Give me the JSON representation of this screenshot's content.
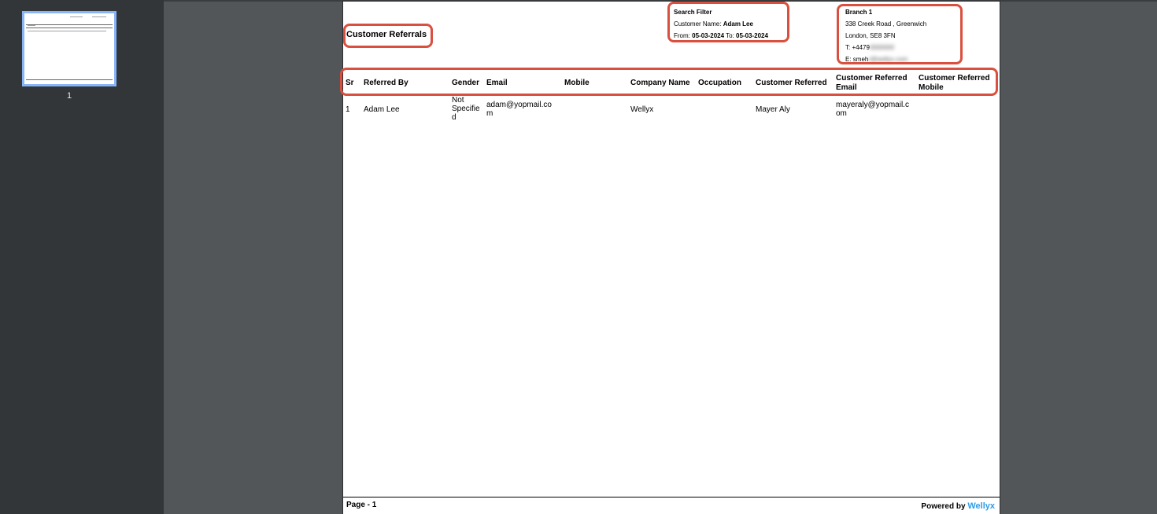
{
  "sidebar": {
    "page_number": "1"
  },
  "report": {
    "title": "Customer Referrals",
    "filter": {
      "heading": "Search Filter",
      "customer_label": "Customer Name:",
      "customer_value": "Adam Lee",
      "from_label": "From:",
      "from_value": "05-03-2024",
      "to_label": "To:",
      "to_value": "05-03-2024"
    },
    "branch": {
      "name": "Branch 1",
      "address_line1": "338 Creek Road , Greenwich",
      "address_line2": "London, SE8 3FN",
      "phone_label": "T:",
      "phone_value": "+4479",
      "phone_redacted": "0000000",
      "email_label": "E:",
      "email_value": "smeh",
      "email_redacted": "r@wellyx.com"
    },
    "columns": {
      "sr": "Sr",
      "referred_by": "Referred By",
      "gender": "Gender",
      "email": "Email",
      "mobile": "Mobile",
      "company_name": "Company Name",
      "occupation": "Occupation",
      "customer_referred": "Customer Referred",
      "customer_referred_email_1": "Customer Referred",
      "customer_referred_email_2": "Email",
      "customer_referred_mobile_1": "Customer Referred",
      "customer_referred_mobile_2": "Mobile"
    },
    "row": {
      "sr": "1",
      "referred_by": "Adam Lee",
      "gender_1": "Not",
      "gender_2": "Specifie",
      "gender_3": "d",
      "email_1": "adam@yopmail.co",
      "email_2": "m",
      "mobile": "",
      "company_name": "Wellyx",
      "occupation": "",
      "customer_referred": "Mayer Aly",
      "customer_referred_email_1": "mayeraly@yopmail.c",
      "customer_referred_email_2": "om",
      "customer_referred_mobile": ""
    },
    "footer": {
      "page": "Page - 1",
      "powered_by": "Powered by",
      "brand": "Wellyx"
    }
  },
  "colors": {
    "highlight": "#d9503f",
    "brand": "#2e9ce6"
  }
}
